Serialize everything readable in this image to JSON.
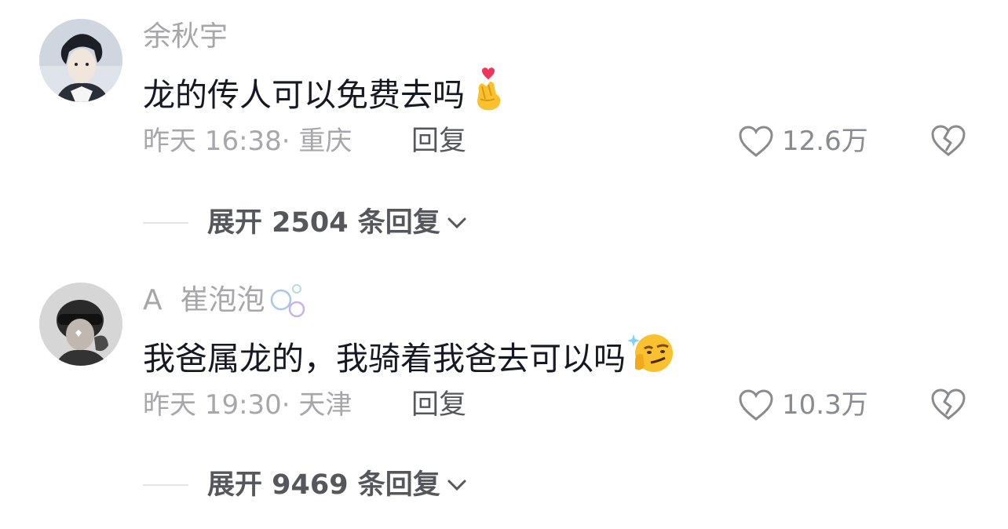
{
  "comments": [
    {
      "username": "余秋宇",
      "text": "龙的传人可以免费去吗",
      "emoji": "crossed-fingers-heart-emoji",
      "time_location": "昨天 16:38· 重庆",
      "reply_label": "回复",
      "likes": "12.6万",
      "expand_label": "展开 2504 条回复"
    },
    {
      "username": "A  崔泡泡",
      "text": "我爸属龙的，我骑着我爸去可以吗",
      "emoji": "smirk-sparkle-emoji",
      "time_location": "昨天 19:30· 天津",
      "reply_label": "回复",
      "likes": "10.3万",
      "expand_label": "展开 9469 条回复"
    }
  ],
  "colors": {
    "username": "#a7a7ab",
    "text": "#161823",
    "meta": "#a7a7ab",
    "action": "#56575c"
  }
}
